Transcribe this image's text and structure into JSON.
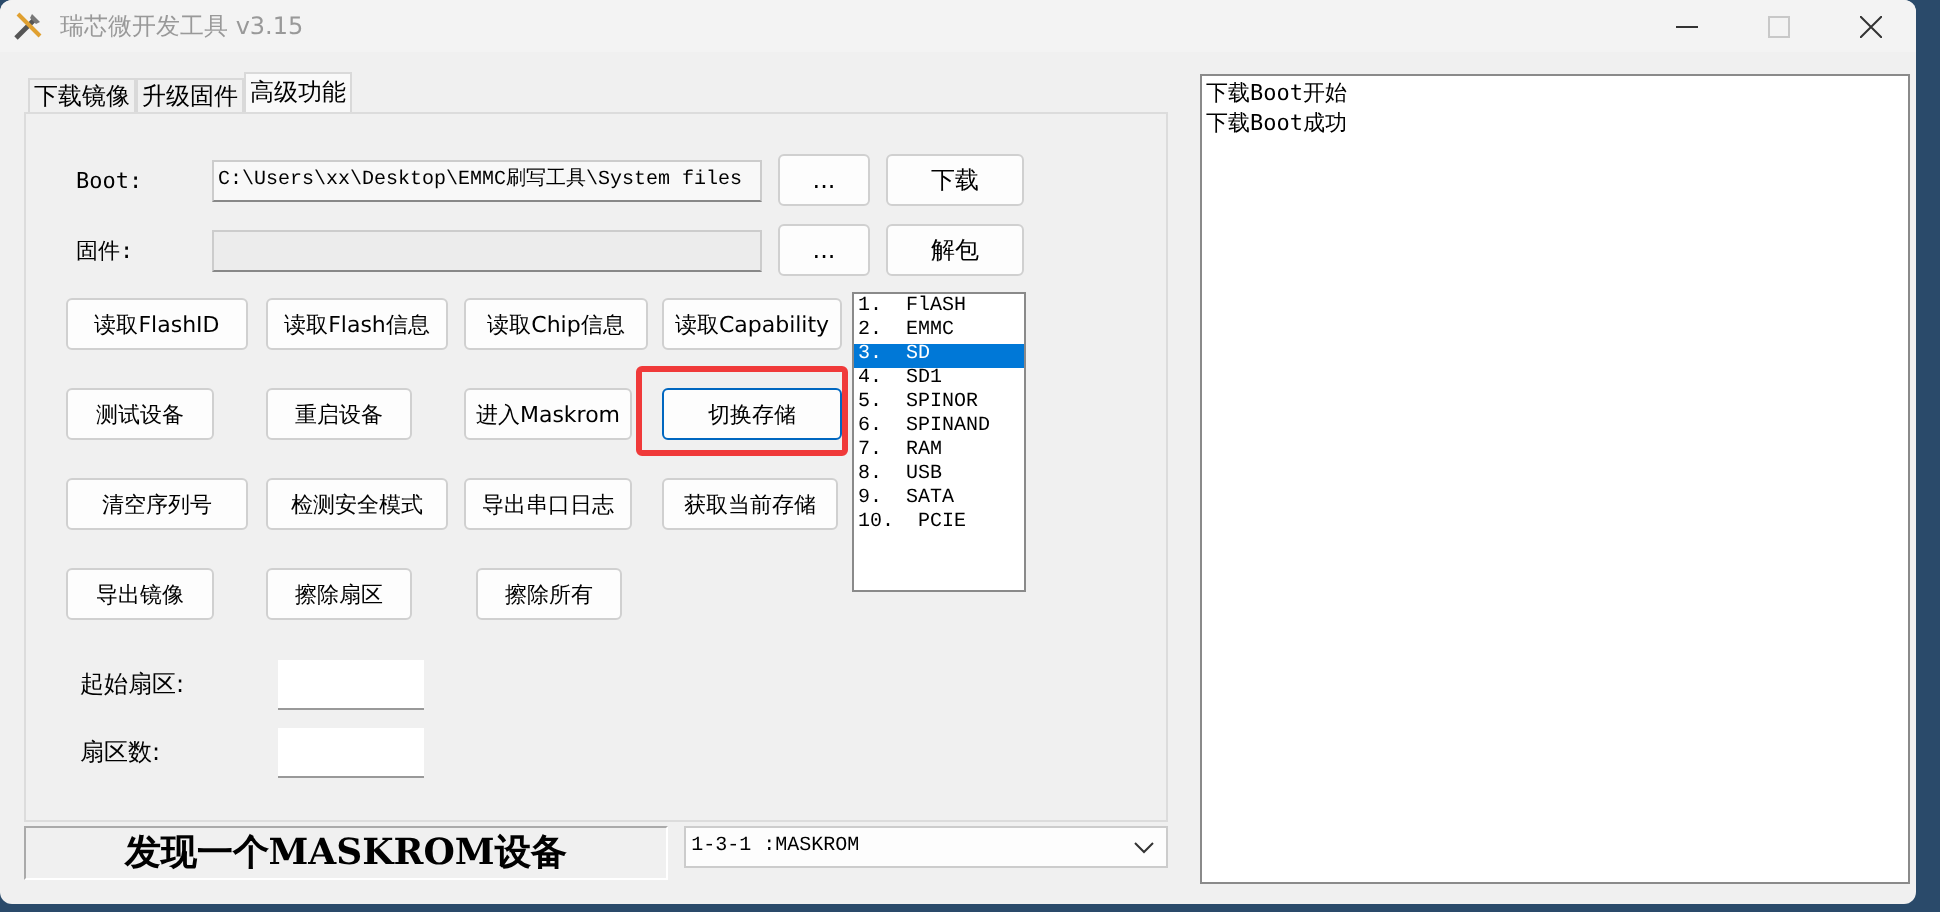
{
  "window": {
    "title": "瑞芯微开发工具 v3.15",
    "maximize_disabled": true
  },
  "tabs": [
    {
      "label": "下载镜像",
      "selected": false
    },
    {
      "label": "升级固件",
      "selected": false
    },
    {
      "label": "高级功能",
      "selected": true
    }
  ],
  "file_rows": [
    {
      "label": "Boot:",
      "value": "C:\\Users\\xx\\Desktop\\EMMC刷写工具\\System files",
      "browse": "...",
      "action": "下载"
    },
    {
      "label": "固件:",
      "value": "",
      "browse": "...",
      "action": "解包"
    }
  ],
  "buttons": [
    [
      {
        "label": "读取FlashID",
        "highlighted": false
      },
      {
        "label": "读取Flash信息",
        "highlighted": false
      },
      {
        "label": "读取Chip信息",
        "highlighted": false
      },
      {
        "label": "读取Capability",
        "highlighted": false
      }
    ],
    [
      {
        "label": "测试设备",
        "highlighted": false
      },
      {
        "label": "重启设备",
        "highlighted": false
      },
      {
        "label": "进入Maskrom",
        "highlighted": false
      },
      {
        "label": "切换存储",
        "highlighted": true
      }
    ],
    [
      {
        "label": "清空序列号",
        "highlighted": false
      },
      {
        "label": "检测安全模式",
        "highlighted": false
      },
      {
        "label": "导出串口日志",
        "highlighted": false
      },
      {
        "label": "获取当前存储",
        "highlighted": false
      }
    ],
    [
      {
        "label": "导出镜像",
        "highlighted": false
      },
      {
        "label": "擦除扇区",
        "highlighted": false
      },
      {
        "label": "擦除所有",
        "highlighted": false
      }
    ]
  ],
  "storage_list": [
    {
      "label": "1.  FlASH",
      "selected": false
    },
    {
      "label": "2.  EMMC",
      "selected": false
    },
    {
      "label": "3.  SD",
      "selected": true
    },
    {
      "label": "4.  SD1",
      "selected": false
    },
    {
      "label": "5.  SPINOR",
      "selected": false
    },
    {
      "label": "6.  SPINAND",
      "selected": false
    },
    {
      "label": "7.  RAM",
      "selected": false
    },
    {
      "label": "8.  USB",
      "selected": false
    },
    {
      "label": "9.  SATA",
      "selected": false
    },
    {
      "label": "10.  PCIE",
      "selected": false
    }
  ],
  "sector_fields": [
    {
      "label": "起始扇区:"
    },
    {
      "label": "扇区数:"
    }
  ],
  "status": "发现一个MASKROM设备",
  "device_select": "1-3-1 :MASKROM",
  "log": [
    "下载Boot开始",
    "下载Boot成功"
  ]
}
